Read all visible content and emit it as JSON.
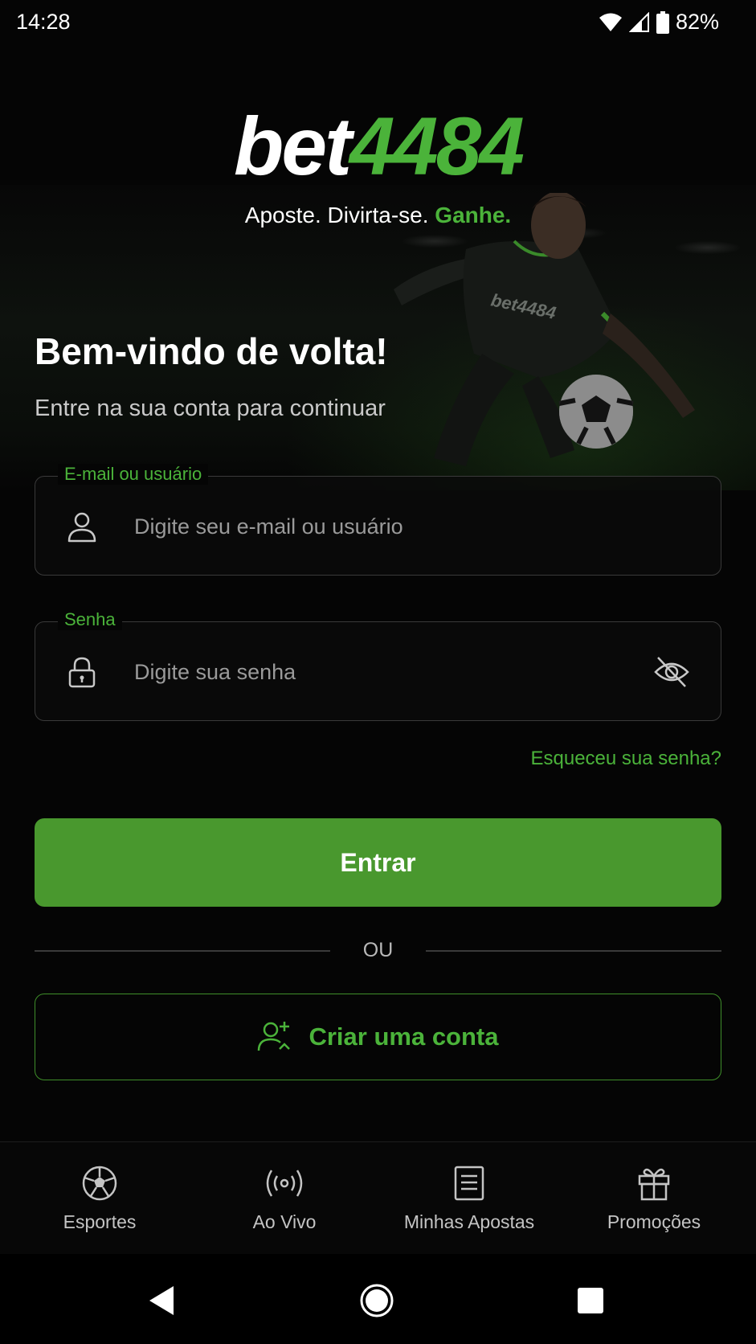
{
  "status_bar": {
    "time": "14:28",
    "battery": "82%",
    "icons": [
      "wifi-icon",
      "signal-icon",
      "battery-icon"
    ]
  },
  "brand": {
    "logo_word": "bet",
    "logo_number": "4484",
    "tagline_main": "Aposte. Divirta-se.",
    "tagline_highlight": "Ganhe.",
    "accent_color": "#4bb33a",
    "primary_button_color": "#49982e"
  },
  "welcome": {
    "title": "Bem-vindo de volta!",
    "subtitle": "Entre na sua conta para continuar"
  },
  "form": {
    "email": {
      "label": "E-mail ou usuário",
      "placeholder": "Digite seu e-mail ou usuário",
      "value": "",
      "icon": "user-icon"
    },
    "password": {
      "label": "Senha",
      "placeholder": "Digite sua senha",
      "value": "",
      "icon": "lock-icon",
      "toggle_icon": "eye-off-icon"
    },
    "forgot_password": "Esqueceu sua senha?",
    "submit_label": "Entrar",
    "divider_text": "OU",
    "create_account_label": "Criar uma conta",
    "create_account_icon": "user-plus-icon"
  },
  "bottom_nav": {
    "items": [
      {
        "label": "Esportes",
        "icon": "soccer-ball-icon"
      },
      {
        "label": "Ao Vivo",
        "icon": "live-broadcast-icon"
      },
      {
        "label": "Minhas Apostas",
        "icon": "document-list-icon"
      },
      {
        "label": "Promoções",
        "icon": "gift-icon"
      }
    ]
  },
  "system_nav": {
    "buttons": [
      "back-icon",
      "home-icon",
      "recents-icon"
    ]
  }
}
